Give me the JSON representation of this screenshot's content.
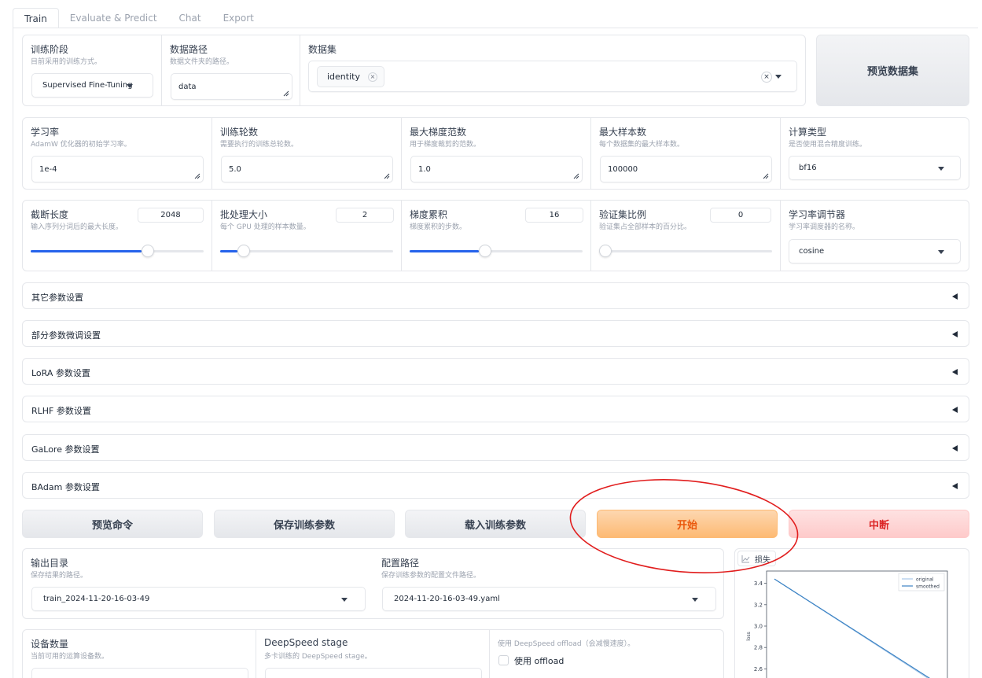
{
  "tabs": [
    "Train",
    "Evaluate & Predict",
    "Chat",
    "Export"
  ],
  "stage": {
    "label": "训练阶段",
    "desc": "目前采用的训练方式。",
    "value": "Supervised Fine-Tuning"
  },
  "dataset_dir": {
    "label": "数据路径",
    "desc": "数据文件夹的路径。",
    "value": "data"
  },
  "dataset": {
    "label": "数据集",
    "tag": "identity",
    "tag_close": "×",
    "clear": "×"
  },
  "preview_dataset_btn": "预览数据集",
  "learning_rate": {
    "label": "学习率",
    "desc": "AdamW 优化器的初始学习率。",
    "value": "1e-4"
  },
  "epochs": {
    "label": "训练轮数",
    "desc": "需要执行的训练总轮数。",
    "value": "5.0"
  },
  "max_grad_norm": {
    "label": "最大梯度范数",
    "desc": "用于梯度裁剪的范数。",
    "value": "1.0"
  },
  "max_samples": {
    "label": "最大样本数",
    "desc": "每个数据集的最大样本数。",
    "value": "100000"
  },
  "compute_type": {
    "label": "计算类型",
    "desc": "是否使用混合精度训练。",
    "value": "bf16"
  },
  "cutoff_len": {
    "label": "截断长度",
    "desc": "输入序列分词后的最大长度。",
    "value": "2048",
    "min": 4,
    "max": 65536
  },
  "batch_size": {
    "label": "批处理大小",
    "desc": "每个 GPU 处理的样本数量。",
    "value": "2",
    "min": 1,
    "max": 1024
  },
  "grad_accum": {
    "label": "梯度累积",
    "desc": "梯度累积的步数。",
    "value": "16",
    "min": 1,
    "max": 1024
  },
  "val_size": {
    "label": "验证集比例",
    "desc": "验证集占全部样本的百分比。",
    "value": "0",
    "min": 0,
    "max": 1
  },
  "lr_scheduler": {
    "label": "学习率调节器",
    "desc": "学习率调度器的名称。",
    "value": "cosine"
  },
  "accordions": [
    "其它参数设置",
    "部分参数微调设置",
    "LoRA 参数设置",
    "RLHF 参数设置",
    "GaLore 参数设置",
    "BAdam 参数设置"
  ],
  "buttons": {
    "preview_cmd": "预览命令",
    "save_args": "保存训练参数",
    "load_args": "载入训练参数",
    "start": "开始",
    "stop": "中断"
  },
  "output_dir": {
    "label": "输出目录",
    "desc": "保存结果的路径。",
    "value": "train_2024-11-20-16-03-49"
  },
  "config_path": {
    "label": "配置路径",
    "desc": "保存训练参数的配置文件路径。",
    "value": "2024-11-20-16-03-49.yaml"
  },
  "device_count": {
    "label": "设备数量",
    "desc": "当前可用的运算设备数。"
  },
  "ds_stage": {
    "label": "DeepSpeed stage",
    "desc": "多卡训练的 DeepSpeed stage。"
  },
  "ds_offload": {
    "desc": "使用 DeepSpeed offload（会减慢速度）。",
    "checkbox_label": "使用 offload"
  },
  "loss_plot": {
    "label": "损失"
  },
  "colors": {
    "accent": "#2563eb",
    "primary": "#fdba74",
    "stop": "#fecaca",
    "annotation": "#e11d1d"
  },
  "chart_data": {
    "type": "line",
    "title": "",
    "xlabel": "",
    "ylabel": "loss",
    "ylim": [
      2.5,
      3.5
    ],
    "yticks": [
      "3.4",
      "3.2",
      "3.0",
      "2.8",
      "2.6"
    ],
    "legend": "top-right",
    "series": [
      {
        "name": "original",
        "x": [
          0,
          1
        ],
        "y": [
          3.44,
          2.5
        ]
      },
      {
        "name": "smoothed",
        "x": [
          0,
          1
        ],
        "y": [
          3.44,
          2.5
        ]
      }
    ]
  }
}
